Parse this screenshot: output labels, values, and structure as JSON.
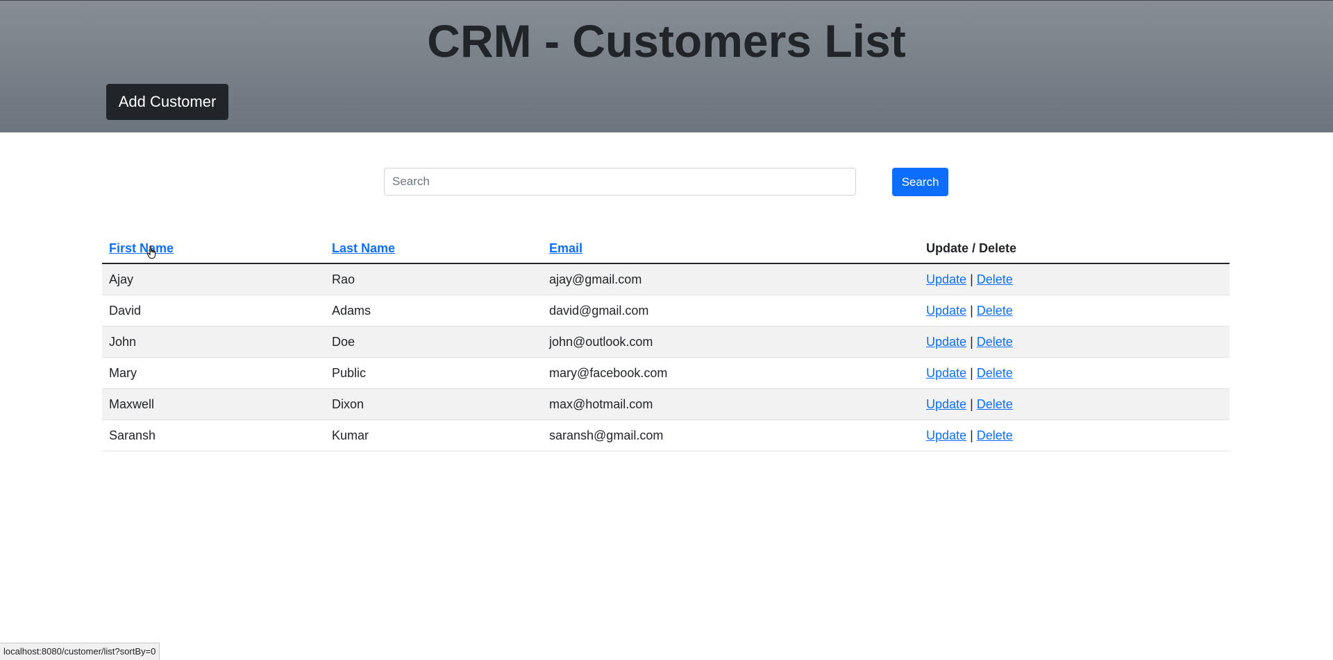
{
  "header": {
    "title": "CRM - Customers List",
    "add_button": "Add Customer"
  },
  "search": {
    "placeholder": "Search",
    "value": "",
    "button_label": "Search"
  },
  "table": {
    "columns": [
      "First Name",
      "Last Name",
      "Email",
      "Update / Delete"
    ],
    "rows": [
      {
        "first_name": "Ajay",
        "last_name": "Rao",
        "email": "ajay@gmail.com"
      },
      {
        "first_name": "David",
        "last_name": "Adams",
        "email": "david@gmail.com"
      },
      {
        "first_name": "John",
        "last_name": "Doe",
        "email": "john@outlook.com"
      },
      {
        "first_name": "Mary",
        "last_name": "Public",
        "email": "mary@facebook.com"
      },
      {
        "first_name": "Maxwell",
        "last_name": "Dixon",
        "email": "max@hotmail.com"
      },
      {
        "first_name": "Saransh",
        "last_name": "Kumar",
        "email": "saransh@gmail.com"
      }
    ],
    "update_label": "Update",
    "delete_label": "Delete",
    "separator": "|"
  },
  "status_bar": {
    "url": "localhost:8080/customer/list?sortBy=0"
  },
  "colors": {
    "primary": "#0d6efd",
    "dark": "#212529",
    "header_gradient_top": "#868d94",
    "header_gradient_bottom": "#6c747d"
  },
  "icons": {
    "cursor": "hand-pointer-icon"
  }
}
